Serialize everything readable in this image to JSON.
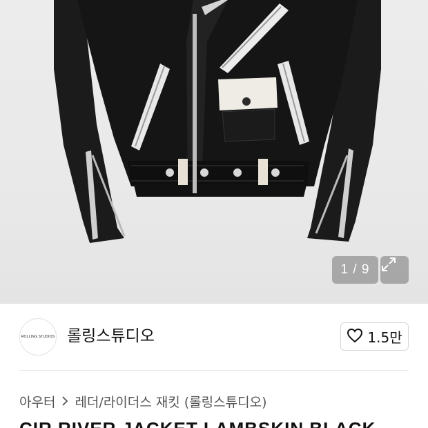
{
  "product_image": {
    "alt": "black leather rider jacket",
    "pager": "1 / 9"
  },
  "seller": {
    "logo_text": "ROLLING STUDIOS",
    "name": "롤링스튜디오",
    "like_count": "1.5만"
  },
  "breadcrumb": {
    "category": "아우터",
    "subcategory": "레더/라이더스 재킷 (롤링스튜디오)"
  },
  "product_title_partial": "CIR RIVER JACKET LAMBSKIN BLACK"
}
